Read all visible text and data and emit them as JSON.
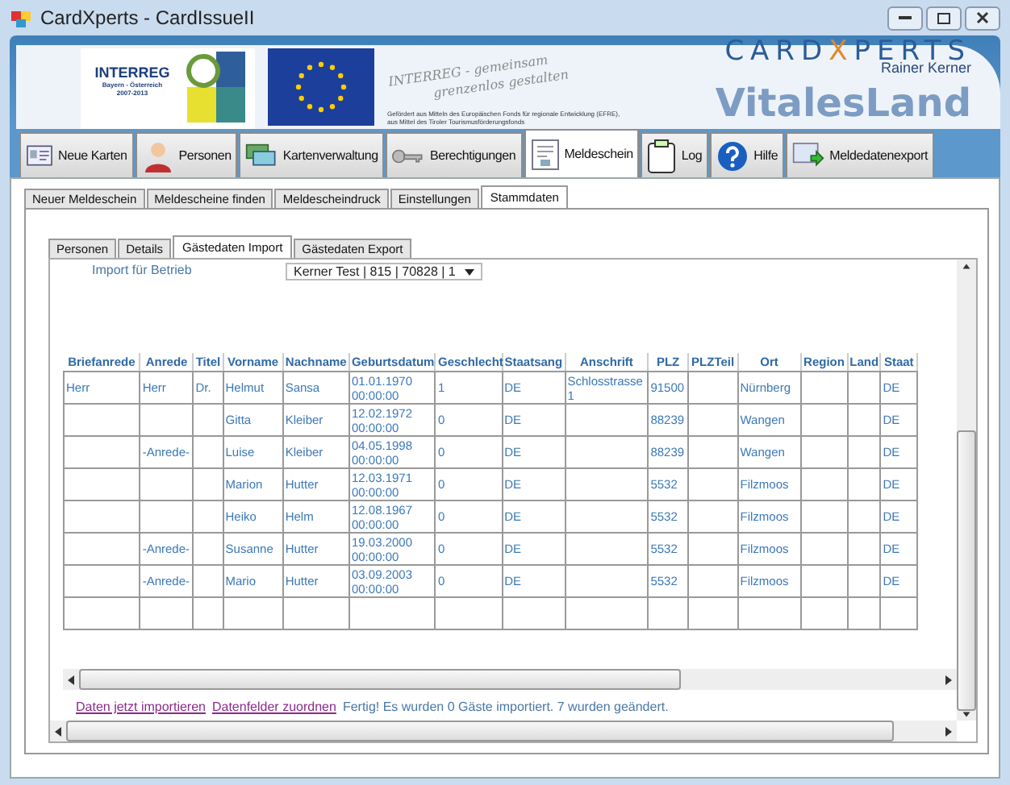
{
  "window": {
    "title": "CardXperts - CardIssueII"
  },
  "banner": {
    "interreg": "INTERREG",
    "region": "Bayern - Österreich",
    "years": "2007-2013",
    "slogan_1": "INTERREG - gemeinsam",
    "slogan_2": "grenzenlos gestalten",
    "funding": "Gefördert aus Mitteln des Europäischen Fonds für regionale Entwicklung (EFRE), aus Mittel des Tiroler Tourismusförderungsfonds",
    "brand_1": "CARD",
    "brand_2": "X",
    "brand_3": "PERTS",
    "owner": "Rainer Kerner",
    "product": "VitalesLand"
  },
  "main_tabs": [
    {
      "label": "Neue Karten",
      "selected": false
    },
    {
      "label": "Personen",
      "selected": false
    },
    {
      "label": "Kartenverwaltung",
      "selected": false
    },
    {
      "label": "Berechtigungen",
      "selected": false
    },
    {
      "label": "Meldeschein",
      "selected": true
    },
    {
      "label": "Log",
      "selected": false
    },
    {
      "label": "Hilfe",
      "selected": false
    },
    {
      "label": "Meldedatenexport",
      "selected": false
    }
  ],
  "sub_tabs": [
    {
      "label": "Neuer Meldeschein",
      "selected": false
    },
    {
      "label": "Meldescheine finden",
      "selected": false
    },
    {
      "label": "Meldescheindruck",
      "selected": false
    },
    {
      "label": "Einstellungen",
      "selected": false
    },
    {
      "label": "Stammdaten",
      "selected": true
    }
  ],
  "inner_tabs": [
    {
      "label": "Personen",
      "selected": false
    },
    {
      "label": "Details",
      "selected": false
    },
    {
      "label": "Gästedaten Import",
      "selected": true
    },
    {
      "label": "Gästedaten Export",
      "selected": false
    }
  ],
  "import": {
    "label": "Import für Betrieb",
    "value": "Kerner Test | 815 | 70828 | 1"
  },
  "table": {
    "columns": [
      "Briefanrede",
      "Anrede",
      "Titel",
      "Vorname",
      "Nachname",
      "Geburtsdatum",
      "Geschlecht",
      "Staatsang",
      "Anschrift",
      "PLZ",
      "PLZTeil",
      "Ort",
      "Region",
      "Land",
      "Staat"
    ],
    "rows": [
      {
        "cells": {
          "0": "Herr",
          "1": "Herr",
          "2": "Dr.",
          "3": "Helmut",
          "4": "Sansa",
          "5": "01.01.1970 00:00:00",
          "6": "1",
          "7": "DE",
          "8": "Schlosstrasse 1",
          "9": "91500",
          "11": "Nürnberg",
          "14": "DE"
        }
      },
      {
        "cells": {
          "3": "Gitta",
          "4": "Kleiber",
          "5": "12.02.1972 00:00:00",
          "6": "0",
          "7": "DE",
          "9": "88239",
          "11": "Wangen",
          "14": "DE"
        }
      },
      {
        "cells": {
          "1": "-Anrede-",
          "3": "Luise",
          "4": "Kleiber",
          "5": "04.05.1998 00:00:00",
          "6": "0",
          "7": "DE",
          "9": "88239",
          "11": "Wangen",
          "14": "DE"
        }
      },
      {
        "cells": {
          "3": "Marion",
          "4": "Hutter",
          "5": "12.03.1971 00:00:00",
          "6": "0",
          "7": "DE",
          "9": "5532",
          "11": "Filzmoos",
          "14": "DE"
        }
      },
      {
        "cells": {
          "3": "Heiko",
          "4": "Helm",
          "5": "12.08.1967 00:00:00",
          "6": "0",
          "7": "DE",
          "9": "5532",
          "11": "Filzmoos",
          "14": "DE"
        }
      },
      {
        "cells": {
          "1": "-Anrede-",
          "3": "Susanne",
          "4": "Hutter",
          "5": "19.03.2000 00:00:00",
          "6": "0",
          "7": "DE",
          "9": "5532",
          "11": "Filzmoos",
          "14": "DE"
        }
      },
      {
        "cells": {
          "1": "-Anrede-",
          "3": "Mario",
          "4": "Hutter",
          "5": "03.09.2003 00:00:00",
          "6": "0",
          "7": "DE",
          "9": "5532",
          "11": "Filzmoos",
          "14": "DE"
        }
      },
      {
        "cells": {}
      }
    ]
  },
  "footer": {
    "links": [
      "Daten jetzt importieren",
      "Datenfelder zuordnen"
    ],
    "status": "Fertig! Es wurden 0 Gäste importiert. 7 wurden geändert."
  }
}
